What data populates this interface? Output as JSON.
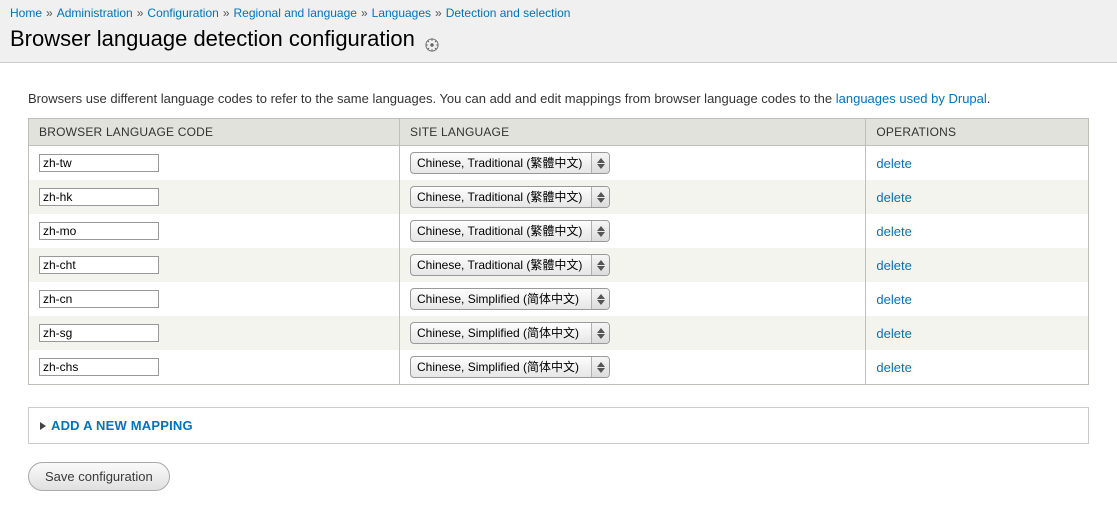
{
  "breadcrumb": [
    {
      "label": "Home"
    },
    {
      "label": "Administration"
    },
    {
      "label": "Configuration"
    },
    {
      "label": "Regional and language"
    },
    {
      "label": "Languages"
    },
    {
      "label": "Detection and selection"
    }
  ],
  "page_title": "Browser language detection configuration",
  "intro": {
    "prefix": "Browsers use different language codes to refer to the same languages. You can add and edit mappings from browser language codes to the ",
    "link": "languages used by Drupal",
    "suffix": "."
  },
  "table": {
    "headers": {
      "code": "BROWSER LANGUAGE CODE",
      "lang": "SITE LANGUAGE",
      "ops": "OPERATIONS"
    },
    "options": [
      "Chinese, Traditional (繁體中文)",
      "Chinese, Simplified (简体中文)"
    ],
    "rows": [
      {
        "code": "zh-tw",
        "selected": "Chinese, Traditional (繁體中文)",
        "op": "delete"
      },
      {
        "code": "zh-hk",
        "selected": "Chinese, Traditional (繁體中文)",
        "op": "delete"
      },
      {
        "code": "zh-mo",
        "selected": "Chinese, Traditional (繁體中文)",
        "op": "delete"
      },
      {
        "code": "zh-cht",
        "selected": "Chinese, Traditional (繁體中文)",
        "op": "delete"
      },
      {
        "code": "zh-cn",
        "selected": "Chinese, Simplified (简体中文)",
        "op": "delete"
      },
      {
        "code": "zh-sg",
        "selected": "Chinese, Simplified (简体中文)",
        "op": "delete"
      },
      {
        "code": "zh-chs",
        "selected": "Chinese, Simplified (简体中文)",
        "op": "delete"
      }
    ]
  },
  "add_mapping_label": "ADD A NEW MAPPING",
  "save_label": "Save configuration"
}
